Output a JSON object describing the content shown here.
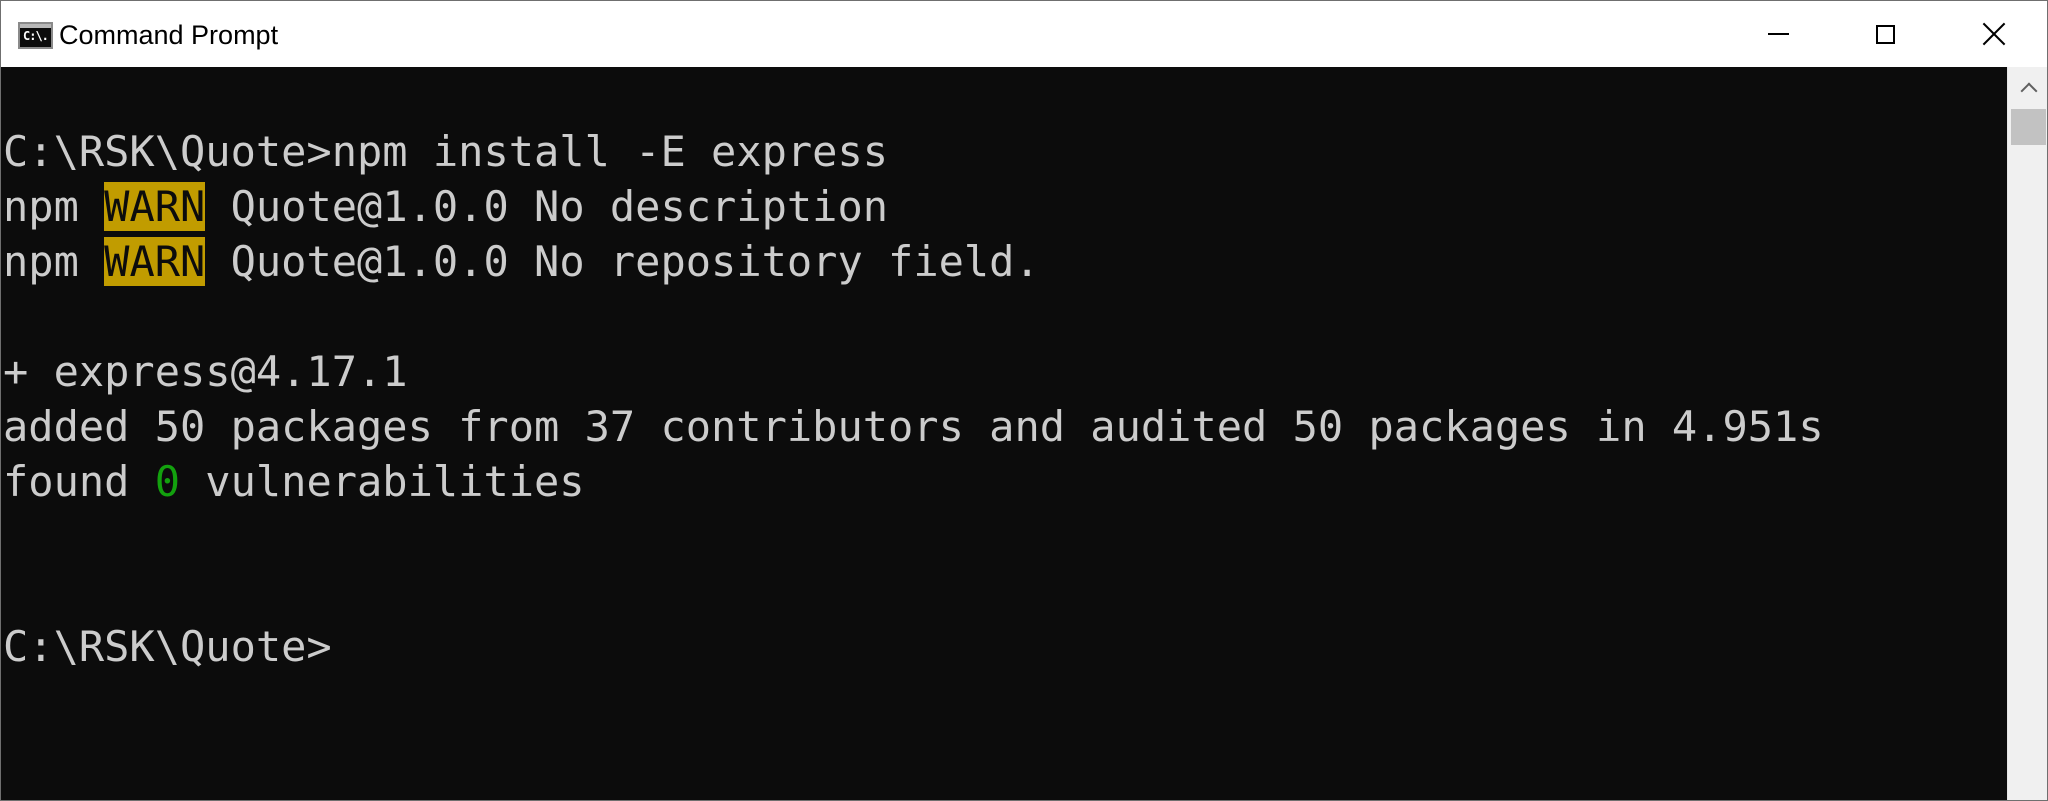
{
  "window": {
    "title": "Command Prompt",
    "app_icon_label": "C:\\.",
    "controls": {
      "minimize": "minimize-icon",
      "maximize": "maximize-icon",
      "close": "close-icon"
    }
  },
  "console": {
    "background": "#0c0c0c",
    "foreground": "#cccccc",
    "warn_background": "#c19c00",
    "success_color": "#13a10e",
    "lines": {
      "cmd_prompt": "C:\\RSK\\Quote>",
      "cmd_text": "npm install -E express",
      "warn1_prefix": "npm ",
      "warn1_tag": "WARN",
      "warn1_text": " Quote@1.0.0 No description",
      "warn2_prefix": "npm ",
      "warn2_tag": "WARN",
      "warn2_text": " Quote@1.0.0 No repository field.",
      "added_pkg": "+ express@4.17.1",
      "summary": "added 50 packages from 37 contributors and audited 50 packages in 4.951s",
      "found_prefix": "found ",
      "found_count": "0",
      "found_suffix": " vulnerabilities",
      "final_prompt": "C:\\RSK\\Quote>"
    }
  }
}
